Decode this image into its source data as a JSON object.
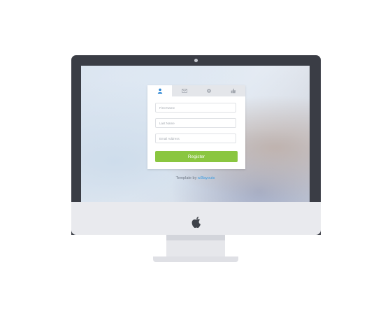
{
  "form": {
    "tabs": [
      {
        "icon": "user-icon",
        "active": true
      },
      {
        "icon": "envelope-icon",
        "active": false
      },
      {
        "icon": "circle-icon",
        "active": false
      },
      {
        "icon": "thumbs-up-icon",
        "active": false
      }
    ],
    "fields": {
      "first_name_placeholder": "First Name",
      "last_name_placeholder": "Last Name",
      "email_placeholder": "Email Address"
    },
    "register_label": "Register"
  },
  "credit": {
    "prefix": "Template by",
    "link_text": "w3layouts"
  },
  "colors": {
    "accent_blue": "#3a9be0",
    "button_green": "#8ac640",
    "bezel": "#3a3d45",
    "chin": "#e9eaee"
  }
}
